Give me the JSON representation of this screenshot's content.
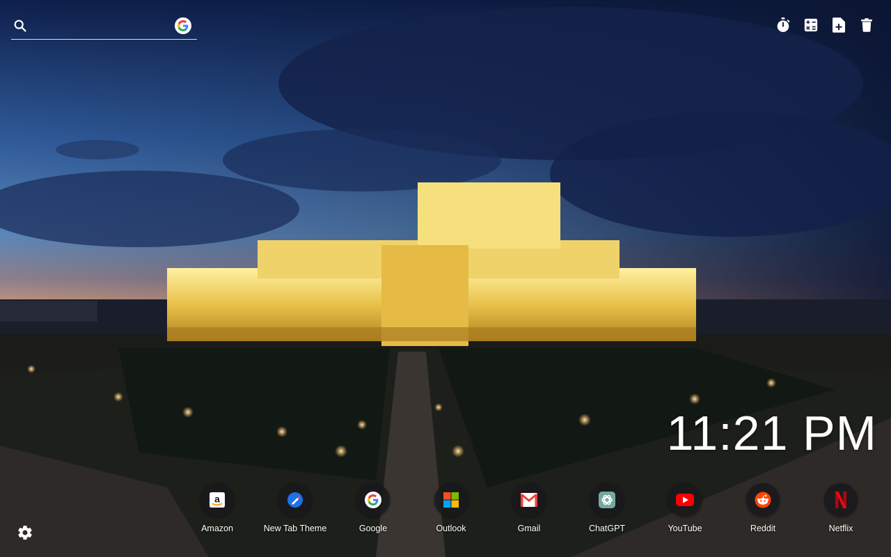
{
  "search": {
    "placeholder": "",
    "engine_icon": "google-g-icon"
  },
  "toolbar": {
    "items": [
      {
        "icon": "stopwatch-icon"
      },
      {
        "icon": "calculator-icon"
      },
      {
        "icon": "new-note-icon"
      },
      {
        "icon": "trash-icon"
      }
    ]
  },
  "clock": {
    "time": "11:21 PM"
  },
  "shortcuts": [
    {
      "label": "Amazon",
      "icon": "amazon-icon"
    },
    {
      "label": "New Tab Theme",
      "icon": "new-tab-theme-icon",
      "color": "#1a73e8"
    },
    {
      "label": "Google",
      "icon": "google-icon"
    },
    {
      "label": "Outlook",
      "icon": "microsoft-icon"
    },
    {
      "label": "Gmail",
      "icon": "gmail-icon",
      "color": "#ea4335"
    },
    {
      "label": "ChatGPT",
      "icon": "chatgpt-icon",
      "color": "#74aa9c"
    },
    {
      "label": "YouTube",
      "icon": "youtube-icon",
      "color": "#ff0000"
    },
    {
      "label": "Reddit",
      "icon": "reddit-icon",
      "color": "#ff4500"
    },
    {
      "label": "Netflix",
      "icon": "netflix-icon",
      "color": "#e50914"
    }
  ],
  "settings": {
    "icon": "gear-icon"
  }
}
